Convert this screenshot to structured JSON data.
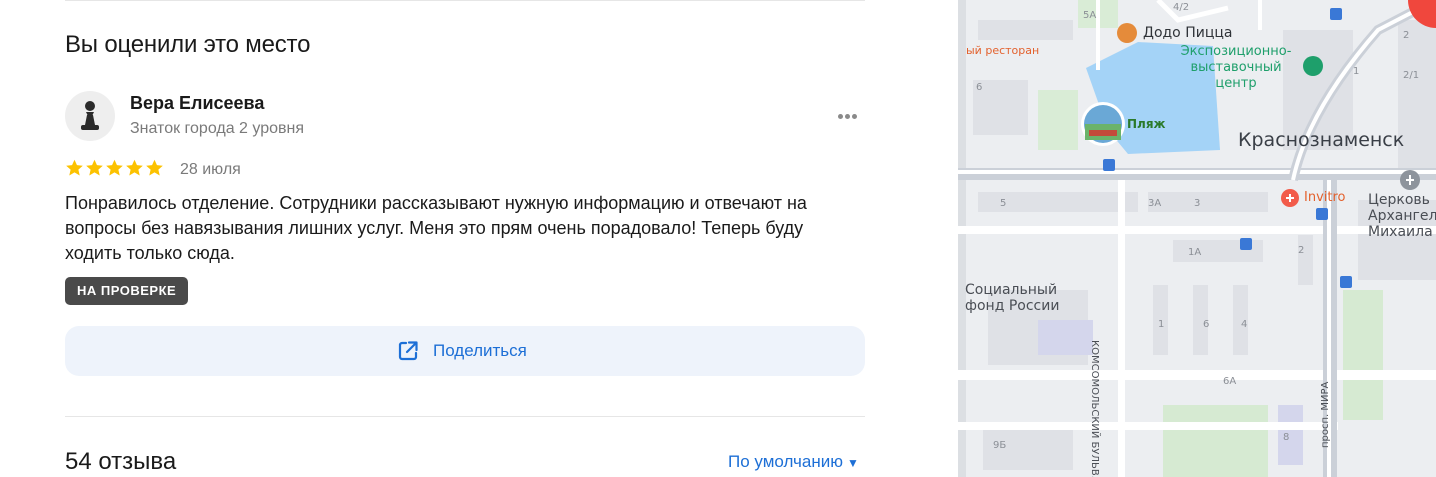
{
  "section": {
    "title": "Вы оценили это место"
  },
  "review": {
    "author": {
      "name": "Вера Елисеева",
      "level": "Знаток города 2 уровня",
      "avatar_icon": "pawn-avatar-icon"
    },
    "rating": 5,
    "date": "28 июля",
    "text": "Понравилось отделение. Сотрудники рассказывают нужную информацию и отвечают на вопросы без навязывания лишних услуг. Меня это прям очень порадовало! Теперь буду ходить только сюда.",
    "status": "НА ПРОВЕРКЕ",
    "more_icon": "more-dots-icon"
  },
  "share": {
    "label": "Поделиться",
    "icon": "share-external-icon"
  },
  "reviews_header": {
    "count_label": "54 отзыва",
    "sort_label": "По умолчанию",
    "sort_icon": "caret-down-icon"
  },
  "colors": {
    "accent": "#1d6fd6",
    "star": "#fcc200",
    "badge": "#4a4a4a",
    "share_bg": "#eef3fb",
    "water": "#a4d3f7"
  },
  "map": {
    "city": "Краснознаменск",
    "restaurant": "ый ресторан",
    "dodo": "Додо Пицца",
    "expo": [
      "Экспозиционно-",
      "выставочный",
      "центр"
    ],
    "beach": "Пляж",
    "invitro": "Invitro",
    "church": [
      "Церковь",
      "Архангел",
      "Михаила"
    ],
    "social": [
      "Социальный",
      "фонд России"
    ],
    "street_komsomolsky": "КОМСОМОЛЬСКИЙ БУЛЬВ.",
    "street_mira": "просп. МИРА",
    "house_numbers": {
      "h5a": "5А",
      "h4_2": "4/2",
      "h6a_top": "6",
      "h2_top": "2",
      "h1_top": "1",
      "h2_1": "2/1",
      "h6": "6",
      "h5": "5",
      "h3a": "3А",
      "h3": "3",
      "h1a": "1А",
      "h2_mid": "2",
      "h1": "1",
      "h6_mid": "6",
      "h4": "4",
      "h6a": "6А",
      "h9b": "9Б",
      "h8": "8"
    }
  }
}
